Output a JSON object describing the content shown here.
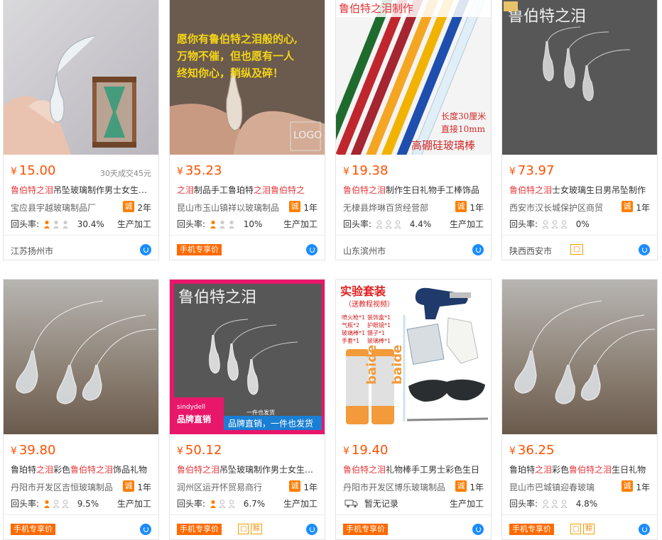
{
  "products": [
    {
      "price": "15.00",
      "sales": "30天成交45元",
      "title_parts": [
        {
          "t": "鲁伯特之泪",
          "hl": true
        },
        {
          "t": "吊坠玻璃制作男士女生礼物",
          "hl": false
        }
      ],
      "shop": "宝应县宇越玻璃制品厂",
      "cheng": "诚",
      "years": "2年",
      "rate_label": "回头率:",
      "rate": "30.4%",
      "service": "生产加工",
      "location": "江苏扬州市",
      "badge": "",
      "badge2": ""
    },
    {
      "price": "35.23",
      "sales": "",
      "title_parts": [
        {
          "t": "之泪",
          "hl": true
        },
        {
          "t": "制品手工鲁珀特",
          "hl": false
        },
        {
          "t": "之泪",
          "hl": true
        },
        {
          "t": "鲁伯特之",
          "hl": true
        }
      ],
      "shop": "昆山市玉山镇祥以玻璃制品",
      "cheng": "诚",
      "years": "1年",
      "rate_label": "回头率:",
      "rate": "10%",
      "service": "生产加工",
      "location": "",
      "badge": "手机专享价",
      "badge2": "",
      "image_text": [
        "愿你有鲁伯特之泪般的心,",
        "万物不催，但也愿有一人",
        "终知你心，稍纵及碎！"
      ],
      "logo_text": "LOGO"
    },
    {
      "price": "19.38",
      "sales": "",
      "title_parts": [
        {
          "t": "鲁伯特之泪",
          "hl": true
        },
        {
          "t": "制作生日礼物手工棒饰品",
          "hl": false
        }
      ],
      "shop": "无棣县烨琳百货经营部",
      "cheng": "诚",
      "years": "1年",
      "rate_label": "回头率:",
      "rate": "4.4%",
      "service": "生产加工",
      "location": "山东滨州市",
      "badge": "",
      "badge2": "",
      "image_title": "鲁伯特之泪制作",
      "image_text": [
        "长度30厘米",
        "直接10mm"
      ],
      "image_sub": "高硼硅玻璃棒"
    },
    {
      "price": "73.97",
      "sales": "",
      "title_parts": [
        {
          "t": "鲁伯特之泪",
          "hl": true
        },
        {
          "t": "士女玻璃生日男吊坠制作",
          "hl": false
        }
      ],
      "shop": "西安市汉长城保护区商贸",
      "cheng": "诚",
      "years": "1年",
      "rate_label": "回头率:",
      "rate": "0%",
      "service": "",
      "location": "陕西西安市",
      "badge": "",
      "badge2": "",
      "image_title": "鲁伯特之泪"
    },
    {
      "price": "39.80",
      "sales": "",
      "title_parts": [
        {
          "t": "鲁珀特",
          "hl": false
        },
        {
          "t": "之泪",
          "hl": true
        },
        {
          "t": "彩色",
          "hl": false
        },
        {
          "t": "鲁伯特之泪",
          "hl": true
        },
        {
          "t": "饰品礼物",
          "hl": false
        }
      ],
      "shop": "丹阳市开发区吉恒玻璃制品",
      "cheng": "诚",
      "years": "1年",
      "rate_label": "回头率:",
      "rate": "9.5%",
      "service": "生产加工",
      "location": "",
      "badge": "手机专享价",
      "badge2": ""
    },
    {
      "price": "50.12",
      "sales": "",
      "title_parts": [
        {
          "t": "鲁伯特之泪",
          "hl": true
        },
        {
          "t": "吊坠玻璃制作男士女生礼物",
          "hl": false
        }
      ],
      "shop": "润州区运开怀贸易商行",
      "cheng": "诚",
      "years": "1年",
      "rate_label": "回头率:",
      "rate": "6.7%",
      "service": "生产加工",
      "location": "",
      "badge": "手机专享价",
      "badge2": "赊",
      "image_title": "鲁伯特之泪",
      "image_text": [
        "sindydell",
        "品牌直销",
        "一件也发货",
        "品牌直销，一件也发货"
      ]
    },
    {
      "price": "19.40",
      "sales": "",
      "title_parts": [
        {
          "t": "鲁伯特之泪",
          "hl": true
        },
        {
          "t": "礼物棒手工男士彩色生日",
          "hl": false
        }
      ],
      "shop": "丹阳市开发区博乐玻璃制品",
      "cheng": "诚",
      "years": "1年",
      "rate_label": "暂无记录",
      "rate": "",
      "service": "生产加工",
      "location": "",
      "badge": "手机专享价",
      "badge2": "",
      "image_title": "实验套装",
      "image_sub": "（送教程视频）",
      "image_text": [
        "喷火枪*1",
        "装饰盒*1",
        "气瓶*2",
        "护眼镜*1",
        "玻璃棒*1",
        "镊子*1",
        "手套*1",
        "玻璃棒*1"
      ],
      "can_text": "baide"
    },
    {
      "price": "36.25",
      "sales": "",
      "title_parts": [
        {
          "t": "鲁珀特",
          "hl": false
        },
        {
          "t": "之泪",
          "hl": true
        },
        {
          "t": "彩色",
          "hl": false
        },
        {
          "t": "鲁伯特之泪",
          "hl": true
        },
        {
          "t": "生日礼物",
          "hl": false
        }
      ],
      "shop": "昆山市巴城镇迎春玻璃",
      "cheng": "诚",
      "years": "1年",
      "rate_label": "回头率:",
      "rate": "4.8%",
      "service": "",
      "location": "",
      "badge": "手机专享价",
      "badge2": "赊"
    }
  ],
  "currency_symbol": "¥"
}
